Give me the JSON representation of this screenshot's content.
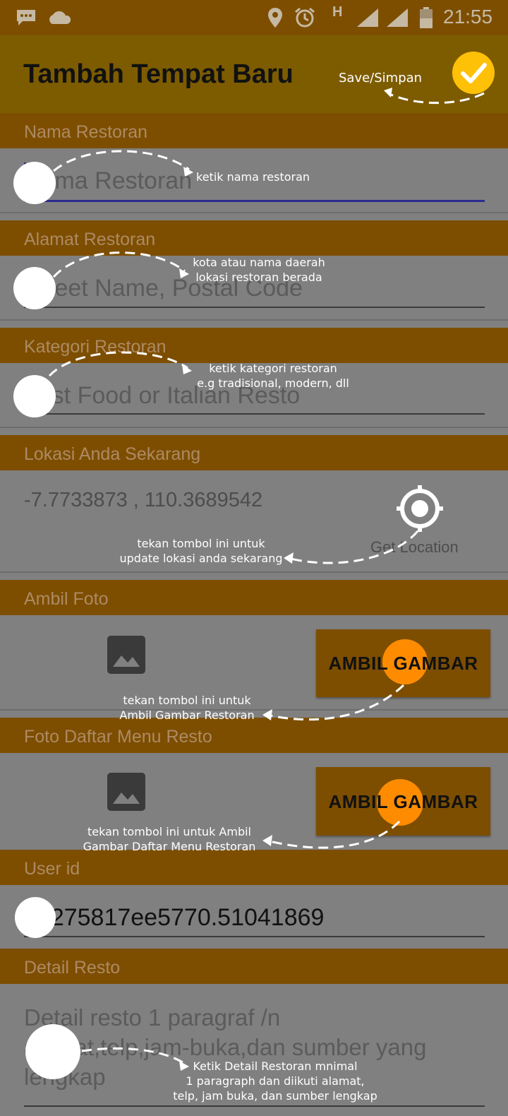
{
  "status_bar": {
    "time": "21:55",
    "network_letter": "H"
  },
  "app_bar": {
    "title": "Tambah Tempat Baru"
  },
  "fields": {
    "nama": {
      "header": "Nama Restoran",
      "placeholder": "Nama Restoran"
    },
    "alamat": {
      "header": "Alamat Restoran",
      "placeholder": "Street Name, Postal Code"
    },
    "kategori": {
      "header": "Kategori Restoran",
      "placeholder": "Fast Food or Italian Resto"
    },
    "lokasi": {
      "header": "Lokasi Anda Sekarang",
      "value": "-7.7733873 , 110.3689542",
      "button_label": "Get Location"
    },
    "foto": {
      "header": "Ambil Foto",
      "button_label": "AMBIL GAMBAR"
    },
    "foto_menu": {
      "header": "Foto Daftar Menu Resto",
      "button_label": "AMBIL GAMBAR"
    },
    "user_id": {
      "header": "User id",
      "value": "56275817ee5770.51041869"
    },
    "detail": {
      "header": "Detail Resto",
      "placeholder_lines": [
        "Detail resto 1 paragraf /n",
        "alamat,telp,jam-buka,dan sumber yang",
        "lengkap"
      ]
    }
  },
  "annotations": {
    "save": "Save/Simpan",
    "nama": "ketik nama restoran",
    "alamat": [
      "kota atau nama daerah",
      "lokasi restoran berada"
    ],
    "kategori": [
      "ketik kategori restoran",
      "e.g tradisional, modern, dll"
    ],
    "lokasi": [
      "tekan tombol ini untuk",
      "update lokasi anda sekarang"
    ],
    "foto": [
      "tekan tombol ini untuk",
      "Ambil Gambar Restoran"
    ],
    "foto_menu": [
      "tekan tombol ini untuk Ambil",
      "Gambar Daftar Menu Restoran"
    ],
    "detail": [
      "Ketik Detail Restoran mnimal",
      "1 paragraph dan diikuti alamat,",
      "telp, jam buka, dan sumber lengkap"
    ]
  },
  "colors": {
    "header_bg": "#7d4e00",
    "appbar_bg": "#7d5c00",
    "save_button": "#ffc107",
    "highlight_orange": "#ff8c00",
    "cursor_underline": "#2b2b8f"
  },
  "icons": [
    "chat-icon",
    "cloud-icon",
    "location-icon",
    "alarm-icon",
    "signal-icon",
    "battery-icon",
    "check-icon",
    "crosshair-icon",
    "image-icon"
  ]
}
